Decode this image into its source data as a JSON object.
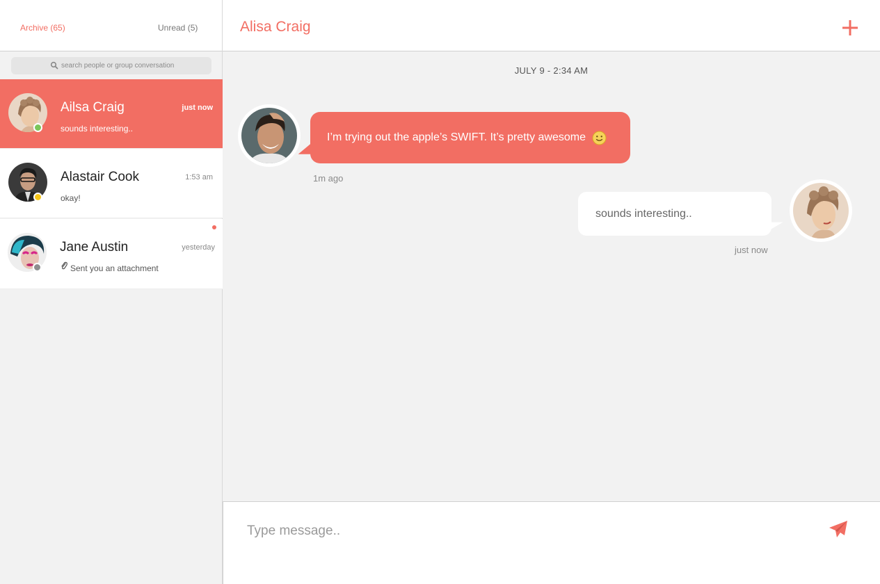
{
  "sidebar": {
    "tabs": {
      "archive": "Archive (65)",
      "unread": "Unread (5)"
    },
    "search": {
      "placeholder": "search people or group conversation",
      "value": ""
    },
    "conversations": [
      {
        "name": "Ailsa Craig",
        "time": "just now",
        "preview": "sounds interesting..",
        "status": "online",
        "active": true
      },
      {
        "name": "Alastair Cook",
        "time": "1:53 am",
        "preview": "okay!",
        "status": "away",
        "active": false
      },
      {
        "name": "Jane Austin",
        "time": "yesterday",
        "preview": "Sent you an attachment",
        "status": "offline",
        "active": false,
        "unread": true,
        "preview_icon": "paperclip-icon"
      }
    ]
  },
  "chat": {
    "title": "Alisa Craig",
    "date_separator": "JULY 9 - 2:34 AM",
    "messages": [
      {
        "direction": "incoming",
        "text": "I’m trying out the apple’s SWIFT. It’s pretty awesome",
        "emoji": "smiley-icon",
        "meta": "1m ago"
      },
      {
        "direction": "outgoing",
        "text": "sounds interesting..",
        "meta": "just now"
      }
    ]
  },
  "composer": {
    "placeholder": "Type message..",
    "value": ""
  },
  "colors": {
    "accent": "#f26e63",
    "online": "#7bc65a",
    "away": "#f5c518",
    "offline": "#8e8e8e",
    "background": "#f2f2f2"
  },
  "icons": {
    "search": "search-icon",
    "add": "plus-icon",
    "send": "paper-plane-icon"
  }
}
